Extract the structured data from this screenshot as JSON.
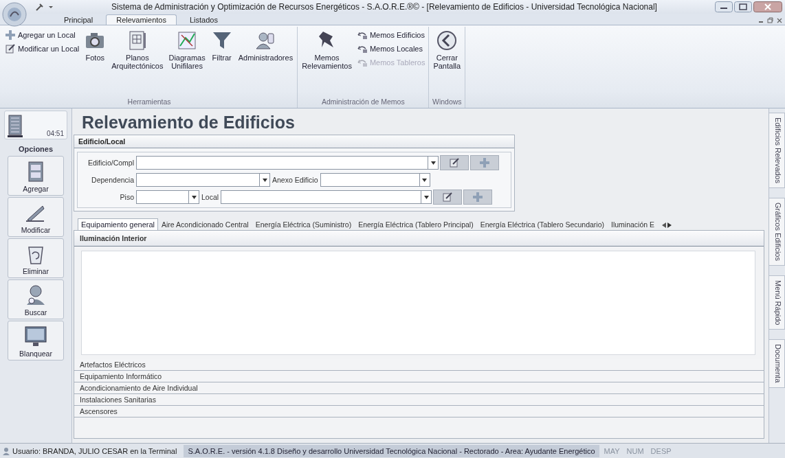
{
  "window": {
    "title": "Sistema de Administración y Optimización de Recursos Energéticos - S.A.O.R.E.®© - [Relevamiento de Edificios - Universidad Tecnológica Nacional]"
  },
  "ribbon_tabs": [
    {
      "label": "Principal",
      "selected": false
    },
    {
      "label": "Relevamientos",
      "selected": true
    },
    {
      "label": "Listados",
      "selected": false
    }
  ],
  "ribbon_groups": [
    {
      "label": "Herramientas",
      "small_buttons": [
        {
          "label": "Agregar un Local",
          "disabled": false
        },
        {
          "label": "Modificar un Local",
          "disabled": false
        }
      ],
      "large_buttons": [
        {
          "label": "Fotos"
        },
        {
          "label": "Planos Arquitectónicos"
        },
        {
          "label": "Diagramas Unifilares"
        },
        {
          "label": "Filtrar"
        },
        {
          "label": "Administradores"
        }
      ]
    },
    {
      "label": "Administración de Memos",
      "large_buttons": [
        {
          "label": "Memos Relevamientos"
        }
      ],
      "small_buttons": [
        {
          "label": "Memos Edificios",
          "disabled": false
        },
        {
          "label": "Memos Locales",
          "disabled": false
        },
        {
          "label": "Memos Tableros",
          "disabled": true
        }
      ]
    },
    {
      "label": "Windows",
      "large_buttons": [
        {
          "label": "Cerrar Pantalla"
        }
      ]
    }
  ],
  "sidebar": {
    "clock": "04:51",
    "title": "Opciones",
    "buttons": [
      "Agregar",
      "Modificar",
      "Eliminar",
      "Buscar",
      "Blanquear"
    ]
  },
  "page_title": "Relevamiento de Edificios",
  "form": {
    "title": "Edificio/Local",
    "rows": [
      [
        {
          "label": "Edificio/Compl",
          "actions": true
        }
      ],
      [
        {
          "label": "Dependencia",
          "actions": false
        },
        {
          "label": "Anexo Edificio",
          "actions": false
        }
      ],
      [
        {
          "label": "Piso",
          "actions": false
        },
        {
          "label": "Local",
          "actions": true
        }
      ]
    ]
  },
  "tabs": [
    {
      "label": "Equipamiento general",
      "selected": true
    },
    {
      "label": "Aire Acondicionado Central",
      "selected": false
    },
    {
      "label": "Energía Eléctrica (Suministro)",
      "selected": false
    },
    {
      "label": "Energía Eléctrica (Tablero Principal)",
      "selected": false
    },
    {
      "label": "Energía Eléctrica (Tablero Secundario)",
      "selected": false
    },
    {
      "label": "Iluminación E",
      "selected": false
    }
  ],
  "sections": [
    {
      "label": "Iluminación Interior",
      "expanded": true
    },
    {
      "label": "Artefactos Eléctricos",
      "expanded": false
    },
    {
      "label": "Equipamiento Informático",
      "expanded": false
    },
    {
      "label": "Acondicionamiento de Aire Individual",
      "expanded": false
    },
    {
      "label": "Instalaciones Sanitarias",
      "expanded": false
    },
    {
      "label": "Ascensores",
      "expanded": false
    }
  ],
  "side_tabs": [
    "Edificios Relevados",
    "Gráficos Edificios",
    "Menú Rápido",
    "Documenta"
  ],
  "status_bar": {
    "user": "Usuario: BRANDA, JULIO CESAR en la Terminal",
    "info": "S.A.O.R.E. - versión 4.1.8 Diseño y desarrollo Universidad Tecnológica Nacional - Rectorado - Area: Ayudante Energético",
    "indicators": [
      {
        "label": "MAY",
        "on": false
      },
      {
        "label": "NUM",
        "on": false
      },
      {
        "label": "DESP",
        "on": false
      }
    ]
  }
}
